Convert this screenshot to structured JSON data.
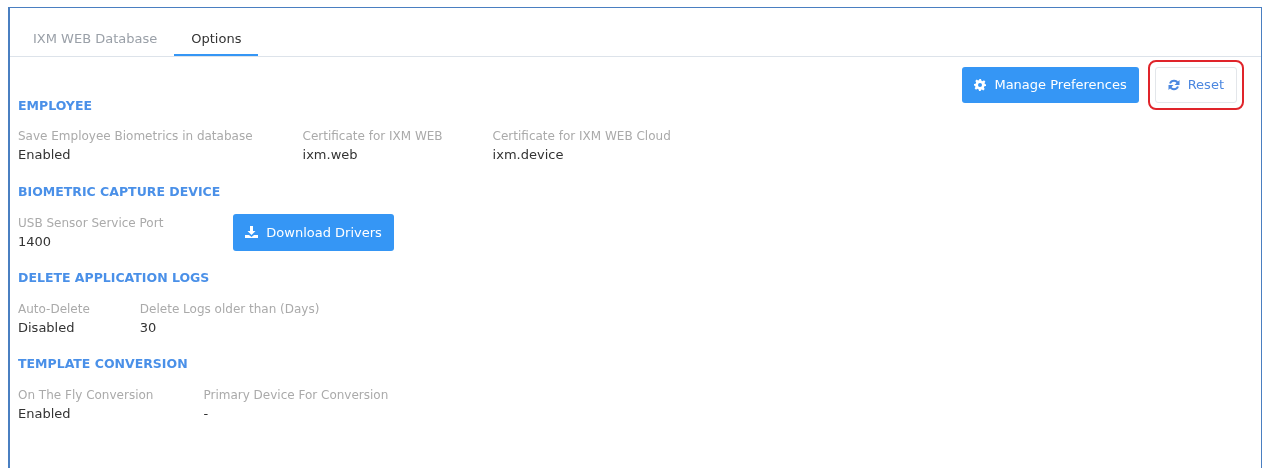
{
  "tabs": [
    {
      "label": "IXM WEB Database",
      "selected": false
    },
    {
      "label": "Options",
      "selected": true
    }
  ],
  "toolbar": [
    {
      "label": "Manage Preferences",
      "kind": "primary",
      "highlighted": false
    },
    {
      "label": "Reset",
      "kind": "light",
      "highlighted": true
    }
  ],
  "sections": [
    {
      "title": "EMPLOYEE",
      "fields": [
        {
          "label": "Save Employee Biometrics in database",
          "value": "Enabled"
        },
        {
          "label": "Certificate for IXM WEB",
          "value": "ixm.web"
        },
        {
          "label": "Certificate for IXM WEB Cloud",
          "value": "ixm.device"
        }
      ]
    },
    {
      "title": "BIOMETRIC CAPTURE DEVICE",
      "fields": [
        {
          "label": "USB Sensor Service Port",
          "value": "1400"
        }
      ],
      "button": {
        "label": "Download Drivers"
      }
    },
    {
      "title": "DELETE APPLICATION LOGS",
      "fields": [
        {
          "label": "Auto-Delete",
          "value": "Disabled"
        },
        {
          "label": "Delete Logs older than (Days)",
          "value": "30"
        }
      ]
    },
    {
      "title": "TEMPLATE CONVERSION",
      "fields": [
        {
          "label": "On The Fly Conversion",
          "value": "Enabled"
        },
        {
          "label": "Primary Device For Conversion",
          "value": "-"
        }
      ]
    }
  ]
}
